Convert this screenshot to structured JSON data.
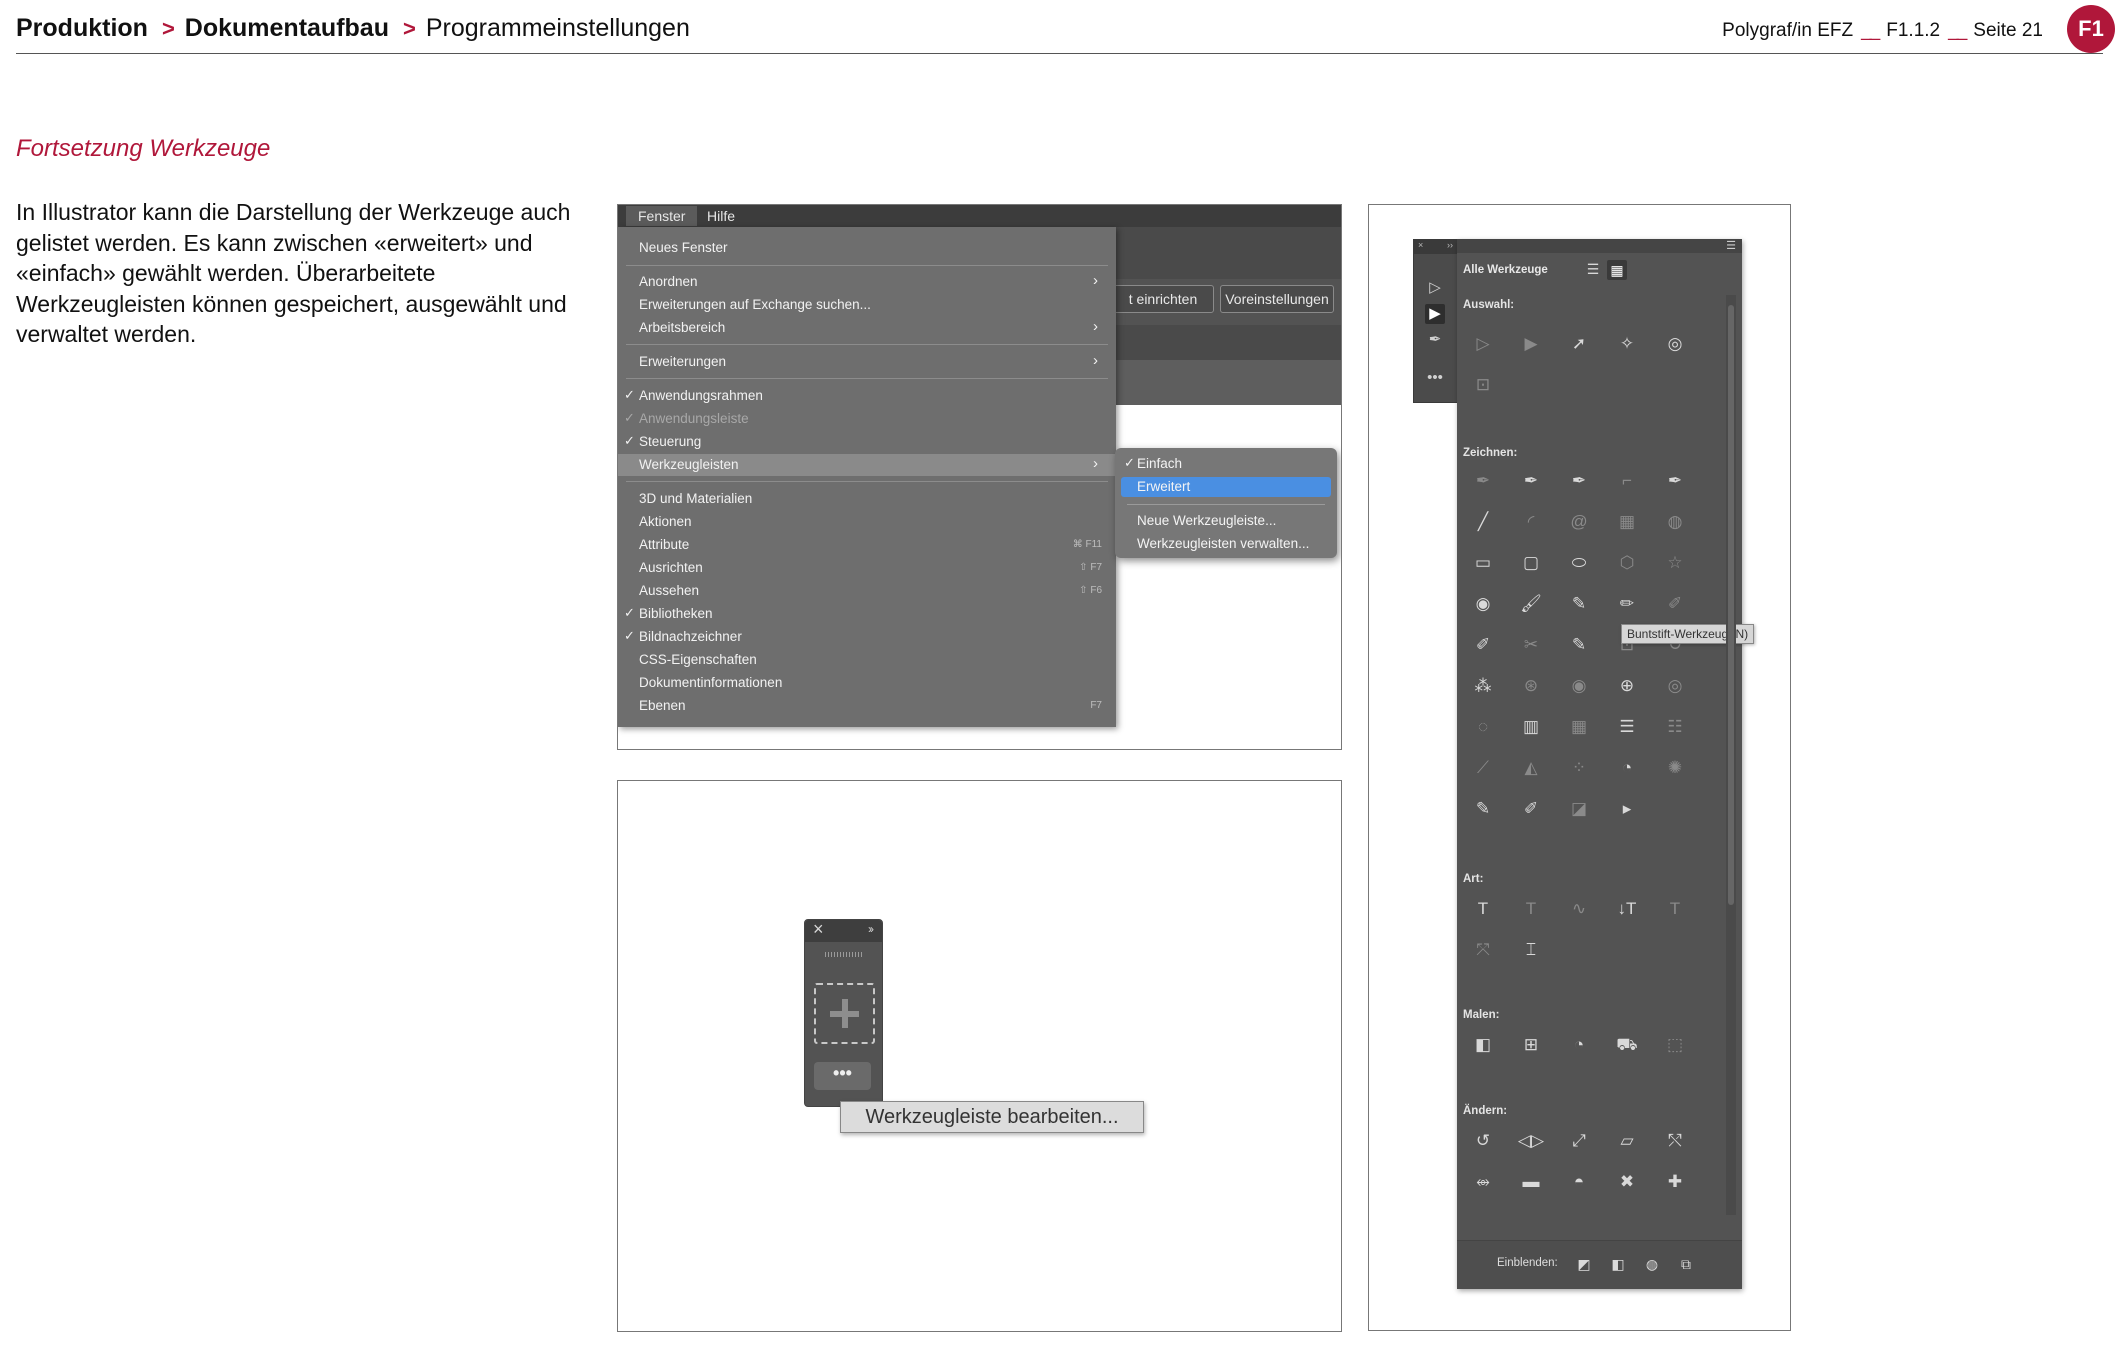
{
  "header": {
    "crumb1": "Produktion",
    "crumb2": "Dokumentaufbau",
    "crumb3": "Programmeinstellungen",
    "chevron": ">",
    "course": "Polygraf/in EFZ",
    "separator": "__",
    "code": "F1.1.2",
    "page": "Seite 21",
    "badge": "F1"
  },
  "section_title": "Fortsetzung Werkzeuge",
  "intro": "In Illustrator kann die Darstellung der Werkzeuge auch gelistet werden. Es kann zwischen «erweitert» und «einfach» gewählt werden. Überarbeitete Werkzeugleisten können gespeichert, ausgewählt und verwaltet werden.",
  "menu_screenshot": {
    "menubar": [
      "Fenster",
      "Hilfe"
    ],
    "app_buttons": [
      "t einrichten",
      "Voreinstellungen"
    ],
    "items": [
      {
        "label": "Neues Fenster",
        "check": "",
        "shortcut": "",
        "arrow": "",
        "state": ""
      },
      {
        "label": "Anordnen",
        "check": "",
        "shortcut": "",
        "arrow": "›",
        "state": ""
      },
      {
        "label": "Erweiterungen auf Exchange suchen...",
        "check": "",
        "shortcut": "",
        "arrow": "",
        "state": ""
      },
      {
        "label": "Arbeitsbereich",
        "check": "",
        "shortcut": "",
        "arrow": "›",
        "state": ""
      },
      {
        "label": "Erweiterungen",
        "check": "",
        "shortcut": "",
        "arrow": "›",
        "state": ""
      },
      {
        "label": "Anwendungsrahmen",
        "check": "✓",
        "shortcut": "",
        "arrow": "",
        "state": ""
      },
      {
        "label": "Anwendungsleiste",
        "check": "✓",
        "shortcut": "",
        "arrow": "",
        "state": "dim"
      },
      {
        "label": "Steuerung",
        "check": "✓",
        "shortcut": "",
        "arrow": "",
        "state": ""
      },
      {
        "label": "Werkzeugleisten",
        "check": "",
        "shortcut": "",
        "arrow": "›",
        "state": "hl"
      },
      {
        "label": "3D und Materialien",
        "check": "",
        "shortcut": "",
        "arrow": "",
        "state": ""
      },
      {
        "label": "Aktionen",
        "check": "",
        "shortcut": "",
        "arrow": "",
        "state": ""
      },
      {
        "label": "Attribute",
        "check": "",
        "shortcut": "⌘ F11",
        "arrow": "",
        "state": ""
      },
      {
        "label": "Ausrichten",
        "check": "",
        "shortcut": "⇧ F7",
        "arrow": "",
        "state": ""
      },
      {
        "label": "Aussehen",
        "check": "",
        "shortcut": "⇧ F6",
        "arrow": "",
        "state": ""
      },
      {
        "label": "Bibliotheken",
        "check": "✓",
        "shortcut": "",
        "arrow": "",
        "state": ""
      },
      {
        "label": "Bildnachzeichner",
        "check": "✓",
        "shortcut": "",
        "arrow": "",
        "state": ""
      },
      {
        "label": "CSS-Eigenschaften",
        "check": "",
        "shortcut": "",
        "arrow": "",
        "state": ""
      },
      {
        "label": "Dokumentinformationen",
        "check": "",
        "shortcut": "",
        "arrow": "",
        "state": ""
      },
      {
        "label": "Ebenen",
        "check": "",
        "shortcut": "F7",
        "arrow": "",
        "state": ""
      }
    ],
    "submenu": [
      {
        "label": "Einfach",
        "check": "✓",
        "state": ""
      },
      {
        "label": "Erweitert",
        "check": "",
        "state": "sel"
      },
      {
        "label": "Neue Werkzeugleiste...",
        "check": "",
        "state": ""
      },
      {
        "label": "Werkzeugleisten verwalten...",
        "check": "",
        "state": ""
      }
    ]
  },
  "toolbar_screenshot": {
    "tooltip": "Werkzeugleiste bearbeiten...",
    "more": "•••"
  },
  "tools_screenshot": {
    "title": "Alle Werkzeuge",
    "tooltip": "Buntstift-Werkzeug (N)",
    "footer_label": "Einblenden:",
    "sections": {
      "auswahl": "Auswahl:",
      "zeichnen": "Zeichnen:",
      "art": "Art:",
      "malen": "Malen:",
      "aendern": "Ändern:"
    }
  }
}
